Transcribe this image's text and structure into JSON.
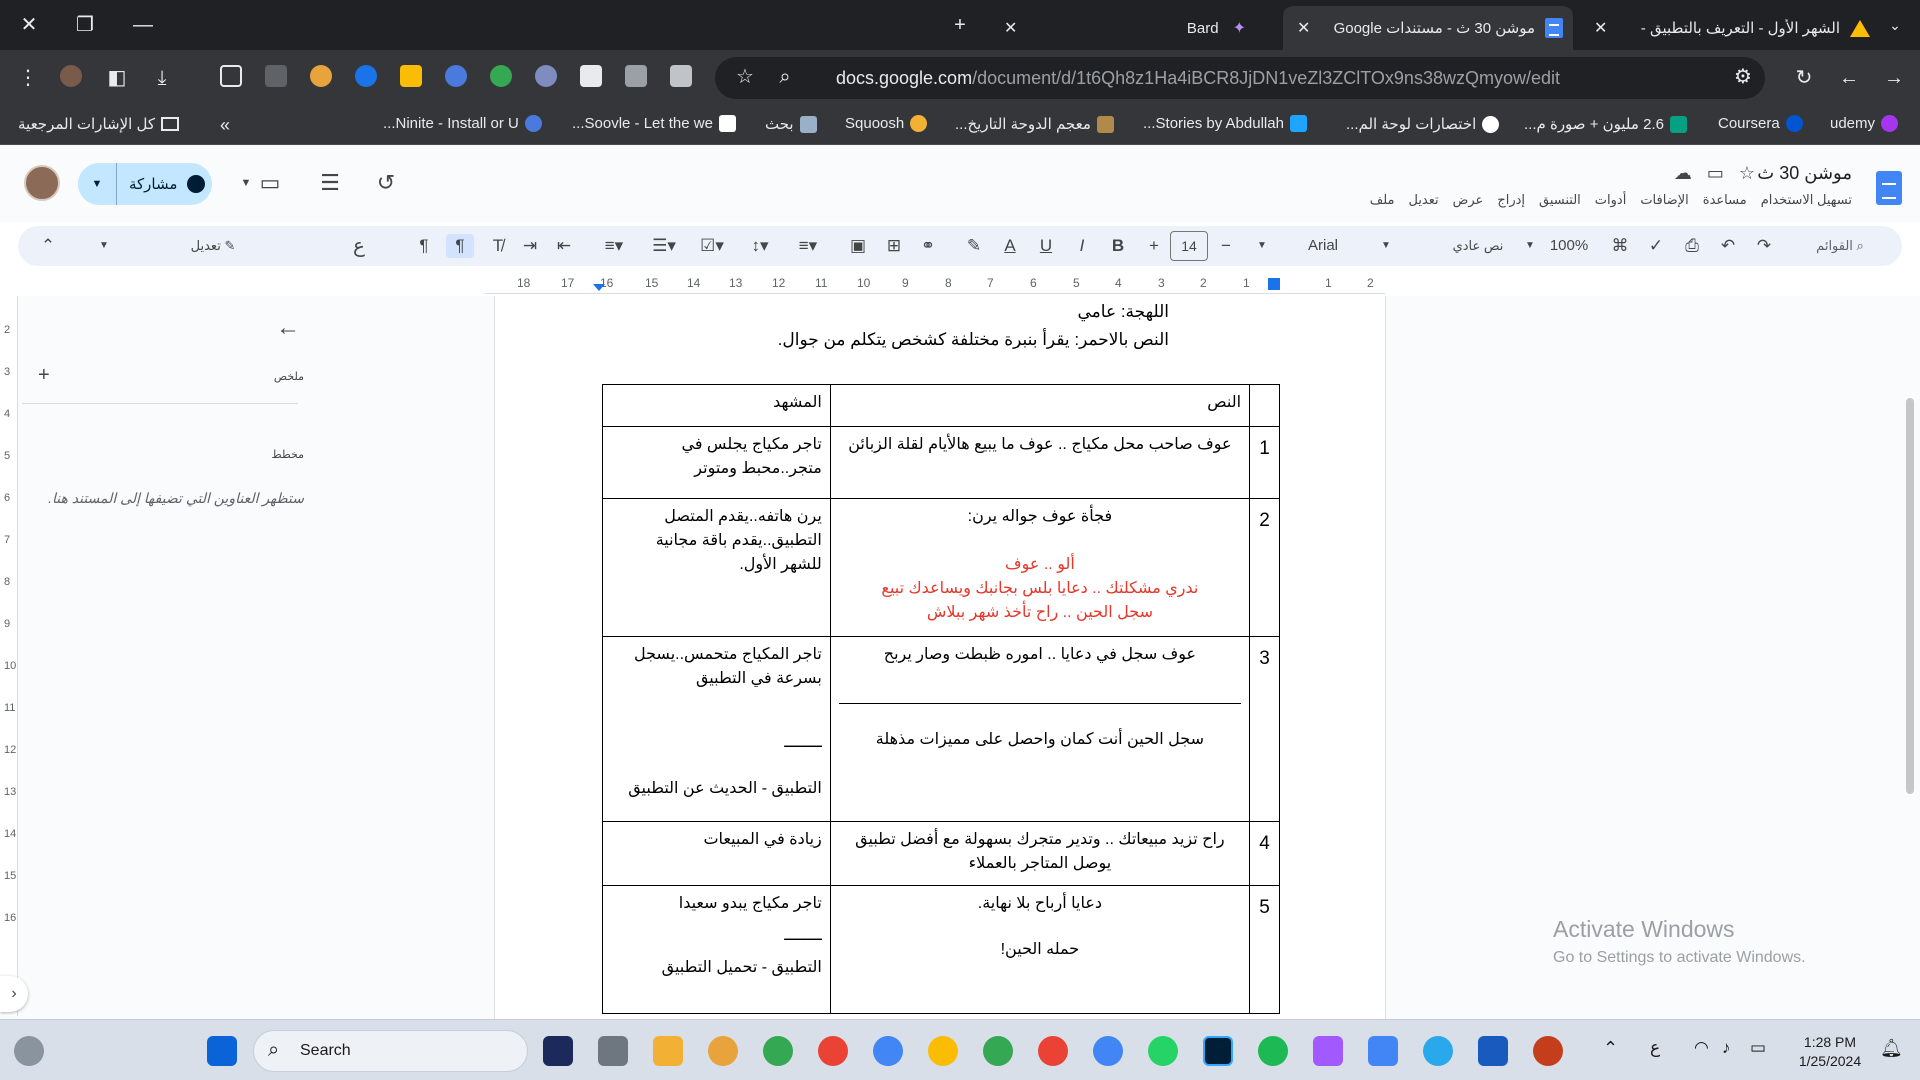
{
  "browser": {
    "tabs": [
      {
        "title": "الشهر الأول - التعريف بالتطبيق -",
        "close": "✕"
      },
      {
        "title": "موشن 30 ث - مستندات Google",
        "close": "✕"
      },
      {
        "title": "Bard",
        "close": "✕"
      }
    ],
    "new_tab": "+",
    "url_host": "docs.google.com",
    "url_path": "/document/d/1t6Qh8z1Ha4iBCR8JjDN1veZl3ZClTOx9ns38wzQmyow/edit",
    "bookmarks": [
      {
        "label": "udemy",
        "color": "#a435f0"
      },
      {
        "label": "Coursera",
        "color": "#0056d2"
      },
      {
        "label": "2.6 مليون + صورة م...",
        "color": "#05a081"
      },
      {
        "label": "اختصارات لوحة الم...",
        "color": "#ffffff"
      },
      {
        "label": "Stories by Abdullah...",
        "color": "#1ea5ff"
      },
      {
        "label": "معجم الدوحة التاريخ...",
        "color": "#b08a4a"
      },
      {
        "label": "Squoosh",
        "color": "#f2b134"
      },
      {
        "label": "بحث",
        "color": "#9ab0c8"
      },
      {
        "label": "Soovle - Let the we...",
        "color": "#ffffff"
      },
      {
        "label": "Ninite - Install or U...",
        "color": "#4a7bdc"
      }
    ],
    "all_bookmarks": "كل الإشارات المرجعية"
  },
  "docs": {
    "title": "موشن 30 ث",
    "menu": [
      "ملف",
      "تعديل",
      "عرض",
      "إدراج",
      "التنسيق",
      "أدوات",
      "الإضافات",
      "مساعدة",
      "تسهيل الاستخدام"
    ],
    "share_label": "مشاركة",
    "toolbar": {
      "search_placeholder": "القوائم",
      "zoom": "100%",
      "style": "نص عادي",
      "font": "Arial",
      "font_size": "14",
      "edit_mode": "تعديل"
    }
  },
  "outline": {
    "summary_label": "ملخص",
    "summary_add": "+",
    "outline_label": "مخطط",
    "outline_hint": "ستظهر العناوين التي تضيفها إلى المستند هنا."
  },
  "document": {
    "dialect_line": "اللهجة: عامي",
    "note_line": "النص بالاحمر: يقرأ بنبرة مختلفة كشخص يتكلم من جوال.",
    "table_headers": {
      "text": "النص",
      "scene": "المشهد"
    },
    "rows": [
      {
        "num": "1",
        "text": "عوف صاحب محل مكياج .. عوف ما يبيع هالأيام لقلة الزبائن",
        "scene": "تاجر مكياج يجلس في متجر..محبط ومتوتر"
      },
      {
        "num": "2",
        "text": "فجأة عوف جواله يرن:",
        "red1": "ألو .. عوف",
        "red2": "ندري مشكلتك .. دعايا بلس بجانبك ويساعدك تبيع",
        "red3": "سجل الحين .. راح تأخذ شهر ببلاش",
        "scene": "يرن هاتفه..يقدم المتصل التطبيق..يقدم باقة مجانية للشهر الأول."
      },
      {
        "num": "3",
        "text": "عوف سجل في دعايا .. اموره ظبطت وصار يربح",
        "text2": "سجل الحين أنت كمان واحصل على مميزات مذهلة",
        "scene": "تاجر المكياج متحمس..يسجل بسرعة في التطبيق",
        "scene_sep": "ــــــــ",
        "scene2": "التطبيق - الحديث عن التطبيق"
      },
      {
        "num": "4",
        "text": "راح تزيد مبيعاتك .. وتدير متجرك بسهولة مع أفضل تطبيق يوصل المتاجر بالعملاء",
        "scene": "زيادة في المبيعات"
      },
      {
        "num": "5",
        "text": "دعايا أرباح بلا نهاية.",
        "text2": "حمله الحين!",
        "scene": "تاجر مكياج يبدو سعيدا",
        "scene_sep": "ــــــــ",
        "scene2": "التطبيق - تحميل التطبيق"
      }
    ]
  },
  "activation": {
    "title": "Activate Windows",
    "subtitle": "Go to Settings to activate Windows."
  },
  "taskbar": {
    "search": "Search",
    "time": "1:28 PM",
    "date": "1/25/2024",
    "lang": "ع"
  }
}
